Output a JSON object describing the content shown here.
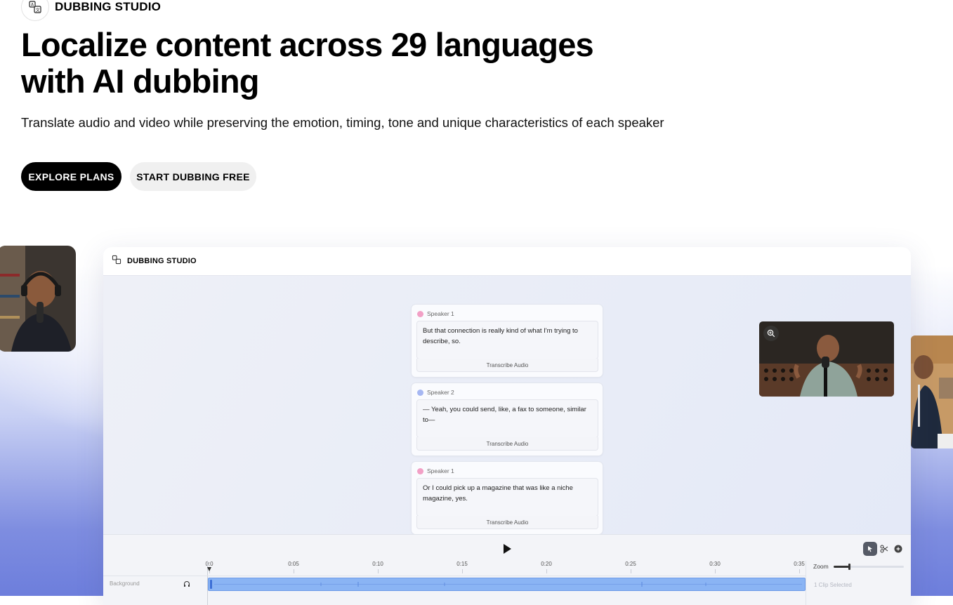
{
  "brand": {
    "label": "DUBBING STUDIO",
    "icon": "translate-icon"
  },
  "hero": {
    "title": "Localize content across 29 languages with AI dubbing",
    "subtitle": "Translate audio and video while preserving the emotion, timing, tone and unique characteristics of each speaker"
  },
  "buttons": {
    "primary": "EXPLORE PLANS",
    "secondary": "START DUBBING FREE"
  },
  "app": {
    "title": "DUBBING STUDIO",
    "cards": [
      {
        "speaker": "Speaker 1",
        "color": "#f2a0c6",
        "text": "But that connection is really kind of what I'm trying to describe, so.",
        "action": "Transcribe Audio"
      },
      {
        "speaker": "Speaker 2",
        "color": "#a6b7f2",
        "text": "— Yeah, you could send, like, a fax to someone, similar to—",
        "action": "Transcribe Audio"
      },
      {
        "speaker": "Speaker 1",
        "color": "#f2a0c6",
        "text": "Or I could pick up a magazine that was like a niche magazine, yes.",
        "action": "Transcribe Audio"
      }
    ],
    "timeline": {
      "ticks": [
        "0:0",
        "0:05",
        "0:10",
        "0:15",
        "0:20",
        "0:25",
        "0:30",
        "0:35"
      ],
      "zoom_label": "Zoom",
      "zoom_level": 0.22,
      "track_name": "Background",
      "clip_status": "1 Clip Selected"
    }
  },
  "colors": {
    "accent_clip": "#8ab4f4",
    "primary_button": "#000000",
    "secondary_button": "#f0f0f0"
  }
}
